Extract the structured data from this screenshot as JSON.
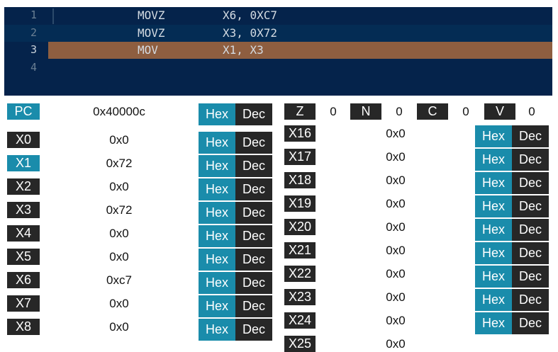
{
  "editor": {
    "lines": [
      {
        "num": "1",
        "op": "MOVZ",
        "args": "X6, 0XC7"
      },
      {
        "num": "2",
        "op": "MOVZ",
        "args": "X3, 0X72"
      },
      {
        "num": "3",
        "op": "MOV",
        "args": "X1, X3"
      },
      {
        "num": "4",
        "op": "",
        "args": ""
      }
    ],
    "highlight_color": "#8e5e40"
  },
  "pc": {
    "label": "PC",
    "value": "0x40000c"
  },
  "toggle": {
    "hex": "Hex",
    "dec": "Dec"
  },
  "flags": [
    {
      "label": "Z",
      "value": "0"
    },
    {
      "label": "N",
      "value": "0"
    },
    {
      "label": "C",
      "value": "0"
    },
    {
      "label": "V",
      "value": "0"
    }
  ],
  "registers_left": [
    {
      "label": "X0",
      "value": "0x0"
    },
    {
      "label": "X1",
      "value": "0x72"
    },
    {
      "label": "X2",
      "value": "0x0"
    },
    {
      "label": "X3",
      "value": "0x72"
    },
    {
      "label": "X4",
      "value": "0x0"
    },
    {
      "label": "X5",
      "value": "0x0"
    },
    {
      "label": "X6",
      "value": "0xc7"
    },
    {
      "label": "X7",
      "value": "0x0"
    },
    {
      "label": "X8",
      "value": "0x0"
    }
  ],
  "registers_right": [
    {
      "label": "X16",
      "value": "0x0"
    },
    {
      "label": "X17",
      "value": "0x0"
    },
    {
      "label": "X18",
      "value": "0x0"
    },
    {
      "label": "X19",
      "value": "0x0"
    },
    {
      "label": "X20",
      "value": "0x0"
    },
    {
      "label": "X21",
      "value": "0x0"
    },
    {
      "label": "X22",
      "value": "0x0"
    },
    {
      "label": "X23",
      "value": "0x0"
    },
    {
      "label": "X24",
      "value": "0x0"
    },
    {
      "label": "X25",
      "value": "0x0"
    }
  ],
  "colors": {
    "accent": "#1a8cab",
    "dark": "#272727",
    "editor_bg": "#05234b"
  }
}
